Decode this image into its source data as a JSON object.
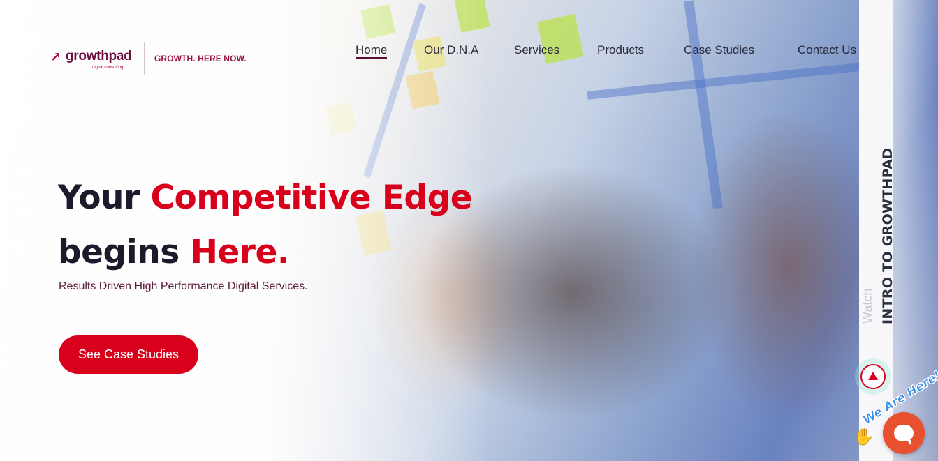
{
  "header": {
    "logo_text": "growthpad",
    "logo_sub": "digital consulting",
    "tagline": "GROWTH. HERE NOW."
  },
  "nav": {
    "items": [
      {
        "label": "Home",
        "active": true
      },
      {
        "label": "Our D.N.A",
        "active": false
      },
      {
        "label": "Services",
        "active": false
      },
      {
        "label": "Products",
        "active": false
      },
      {
        "label": "Case Studies",
        "active": false
      },
      {
        "label": "Contact Us",
        "active": false
      }
    ]
  },
  "hero": {
    "headline_part1": "Your ",
    "headline_highlight1": "Competitive Edge",
    "headline_part2": "begins ",
    "headline_highlight2": "Here.",
    "subheadline": "Results Driven High Performance Digital Services.",
    "cta_label": "See Case Studies"
  },
  "side_video": {
    "watch_label": "Watch",
    "title": "INTRO TO GROWTHPAD"
  },
  "chat": {
    "badge_text": "We Are Here!"
  },
  "colors": {
    "accent_red": "#d9001b",
    "brand_maroon": "#6b0f3d",
    "chat_orange": "#e8502f"
  },
  "icons": [
    "logo-mark-icon",
    "play-icon",
    "wave-hand-icon",
    "chat-bubble-icon"
  ]
}
